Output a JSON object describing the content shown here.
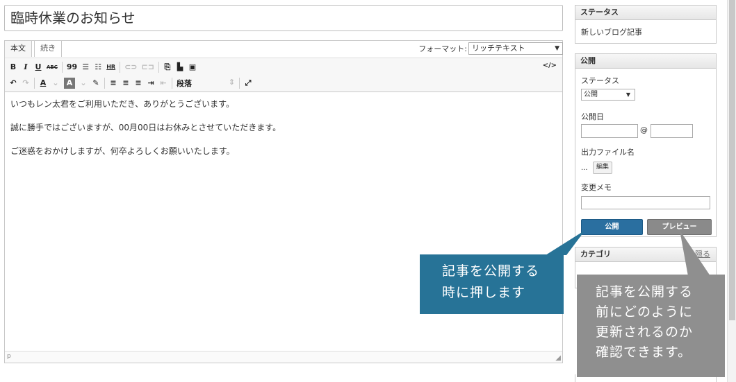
{
  "editor": {
    "title_value": "臨時休業のお知らせ",
    "tabs": [
      {
        "label": "本文"
      },
      {
        "label": "続き"
      }
    ],
    "format_label": "フォーマット:",
    "format_value": "リッチテキスト",
    "toolbar": {
      "bold": "B",
      "italic": "I",
      "underline": "U",
      "strike": "ABC",
      "quote": "99",
      "hr": "HR",
      "code": "</>",
      "paragraph": "段落"
    },
    "content": [
      "いつもレン太君をご利用いただき、ありがとうございます。",
      "誠に勝手ではございますが、00月00日はお休みとさせていただきます。",
      "ご迷惑をおかけしますが、何卒よろしくお願いいたします。"
    ],
    "status_path": "p"
  },
  "sidebar": {
    "status_widget": {
      "title": "ステータス",
      "value": "新しいブログ記事"
    },
    "publish_widget": {
      "title": "公開",
      "status_label": "ステータス",
      "status_value": "公開",
      "date_label": "公開日",
      "at_sign": "@",
      "filename_label": "出力ファイル名",
      "filename_value": "...",
      "edit_button": "編集",
      "memo_label": "変更メモ",
      "publish_button": "公開",
      "preview_button": "プレビュー"
    },
    "category_widget": {
      "title": "カテゴリ",
      "toggle": "隠る"
    }
  },
  "callouts": {
    "publish": [
      "記事を公開する",
      "時に押します"
    ],
    "preview": [
      "記事を公開する",
      "前にどのように",
      "更新されるのか",
      "確認できます。"
    ]
  },
  "colors": {
    "publish_button": "#2a6fa0",
    "callout_publish": "#277397",
    "callout_preview": "#8f8f8f",
    "preview_button": "#8a8a8a"
  }
}
